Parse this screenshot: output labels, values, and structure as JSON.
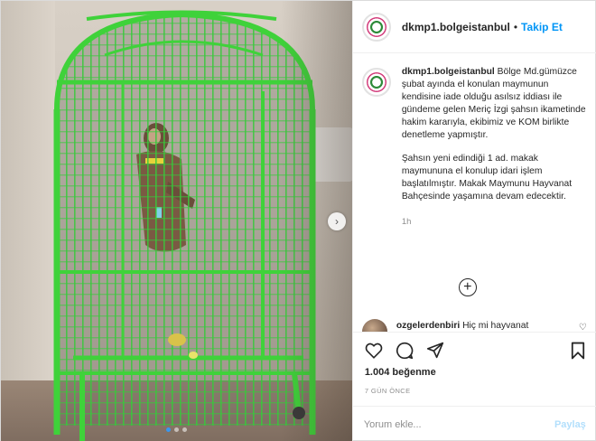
{
  "header": {
    "username": "dkmp1.bolgeistanbul",
    "separator": "•",
    "follow_label": "Takip Et"
  },
  "caption": {
    "username": "dkmp1.bolgeistanbul",
    "paragraph1": "Bölge Md.gümüzce şubat ayında el konulan maymunun kendisine iade olduğu asılsız iddiası ile gündeme gelen Meriç İzgi şahsın ikametinde hakim kararıyla, ekibimiz ve KOM birlikte denetleme yapmıştır.",
    "paragraph2": "Şahsın yeni edindiği 1 ad. makak maymununa el konulup idari işlem başlatılmıştır. Makak Maymunu Hayvanat Bahçesinde yaşamına devam edecektir.",
    "time": "1h"
  },
  "comment_peek": {
    "username": "ozgelerdenbiri",
    "text": "Hiç mi hayvanat"
  },
  "likes": "1.004 beğenme",
  "date": "7 GÜN ÖNCE",
  "comment_input": {
    "placeholder": "Yorum ekle...",
    "post_label": "Paylaş"
  },
  "media": {
    "slide_count": 3,
    "active_slide": 1
  },
  "icons": {
    "like": "heart-icon",
    "comment": "comment-icon",
    "share": "share-icon",
    "save": "bookmark-icon",
    "more_comments": "plus-circle-icon",
    "next": "chevron-right-icon"
  },
  "colors": {
    "follow": "#0095f6",
    "post_button": "#b2dffc",
    "cage": "#3fd23a"
  }
}
